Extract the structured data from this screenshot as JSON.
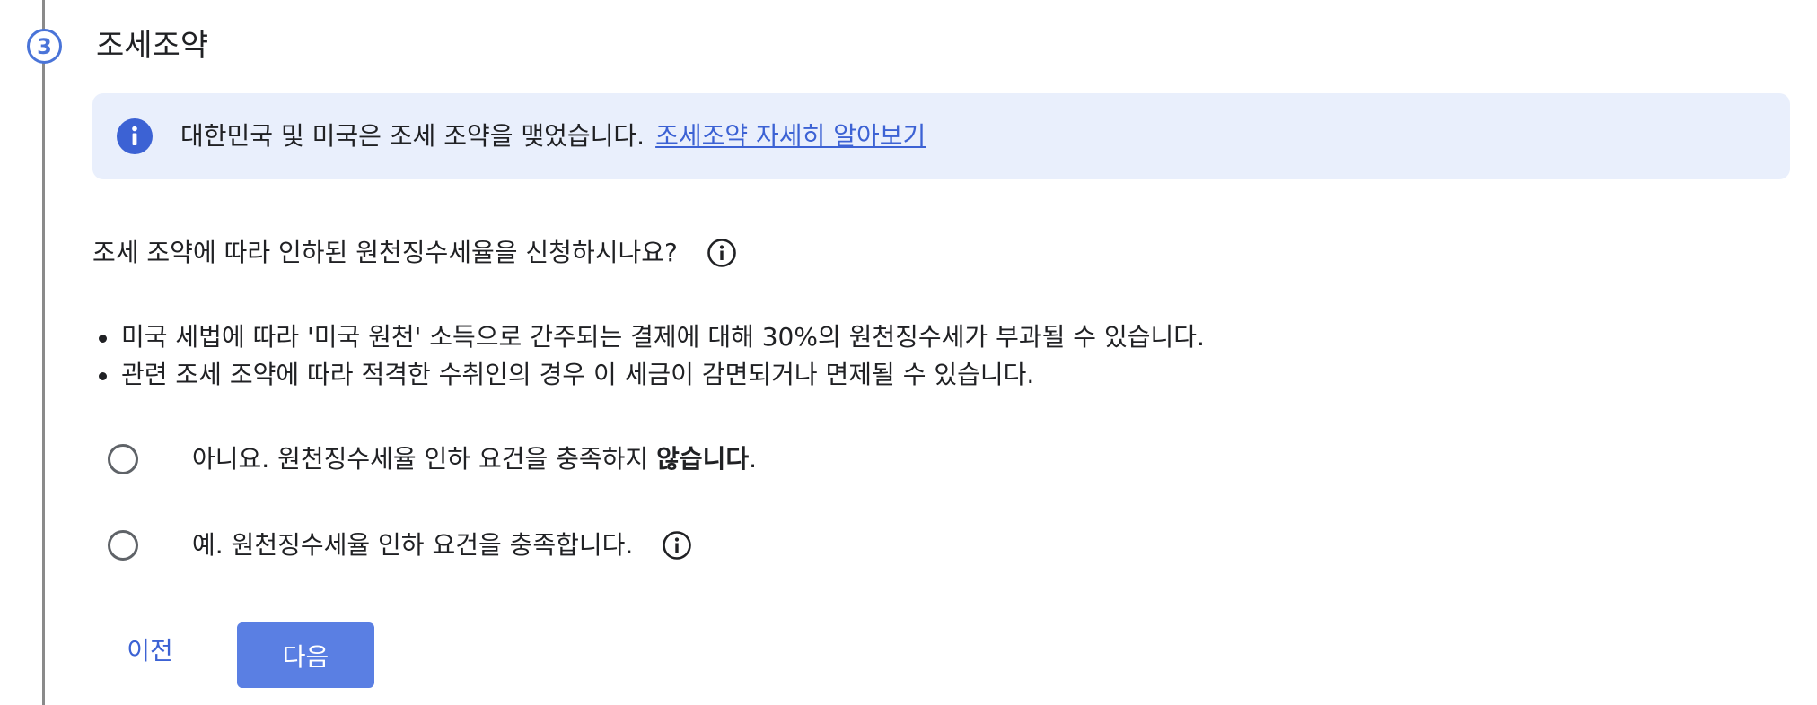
{
  "step": {
    "number": "3",
    "title": "조세조약"
  },
  "info_banner": {
    "icon": "info-filled-icon",
    "text": "대한민국 및 미국은 조세 조약을 맺었습니다.",
    "link_text": "조세조약 자세히 알아보기"
  },
  "question": {
    "text": "조세 조약에 따라 인하된 원천징수세율을 신청하시나요?",
    "icon": "info-outline-icon"
  },
  "bullets": [
    "미국 세법에 따라 '미국 원천' 소득으로 간주되는 결제에 대해 30%의 원천징수세가 부과될 수 있습니다.",
    "관련 조세 조약에 따라 적격한 수취인의 경우 이 세금이 감면되거나 면제될 수 있습니다."
  ],
  "options": [
    {
      "label_prefix": "아니요. 원천징수세율 인하 요건을 충족하지 ",
      "label_bold": "않습니다",
      "label_suffix": ".",
      "selected": false
    },
    {
      "label": "예. 원천징수세율 인하 요건을 충족합니다.",
      "icon": "info-outline-icon",
      "selected": false
    }
  ],
  "buttons": {
    "prev_label": "이전",
    "next_label": "다음"
  },
  "colors": {
    "accent": "#3c62d4",
    "primary_button": "#5a7fe3",
    "banner_bg": "#e9effc",
    "step_line": "#8a8a8a"
  }
}
